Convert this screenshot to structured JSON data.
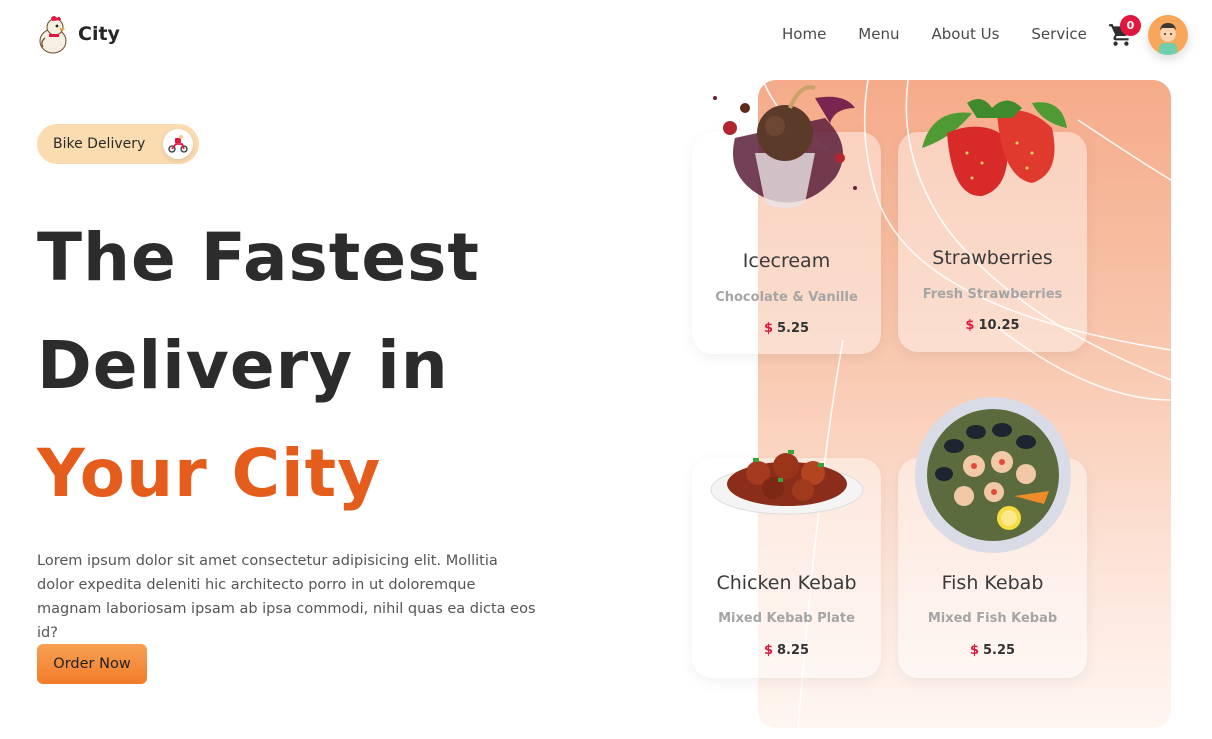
{
  "brand": {
    "name": "City",
    "logo_icon": "chef-chicken-icon"
  },
  "nav": {
    "items": [
      {
        "label": "Home"
      },
      {
        "label": "Menu"
      },
      {
        "label": "About Us"
      },
      {
        "label": "Service"
      }
    ],
    "cart_count": "0",
    "cart_icon": "shopping-cart-icon",
    "avatar_icon": "user-avatar-icon"
  },
  "hero": {
    "pill_label": "Bike Delivery",
    "pill_icon": "scooter-icon",
    "line1": "The Fastest",
    "line2": "Delivery in",
    "line3": "Your City",
    "description": "Lorem ipsum dolor sit amet consectetur adipisicing elit. Mollitia dolor expedita deleniti hic architecto porro in ut doloremque magnam laboriosam ipsam ab ipsa commodi, nihil quas ea dicta eos id?",
    "cta_label": "Order Now"
  },
  "menu": {
    "currency": "$",
    "items": [
      {
        "title": "Icecream",
        "subtitle": "Chocolate & Vanille",
        "price": "5.25",
        "icon": "icecream-icon"
      },
      {
        "title": "Strawberries",
        "subtitle": "Fresh Strawberries",
        "price": "10.25",
        "icon": "strawberry-icon"
      },
      {
        "title": "Chicken Kebab",
        "subtitle": "Mixed Kebab Plate",
        "price": "8.25",
        "icon": "chicken-kebab-icon"
      },
      {
        "title": "Fish Kebab",
        "subtitle": "Mixed Fish Kebab",
        "price": "5.25",
        "icon": "fish-kebab-icon"
      }
    ]
  },
  "colors": {
    "accent": "#e55d1c",
    "badge": "#e1173f",
    "pill": "#fbdcb0",
    "button": "#f27c2b"
  }
}
